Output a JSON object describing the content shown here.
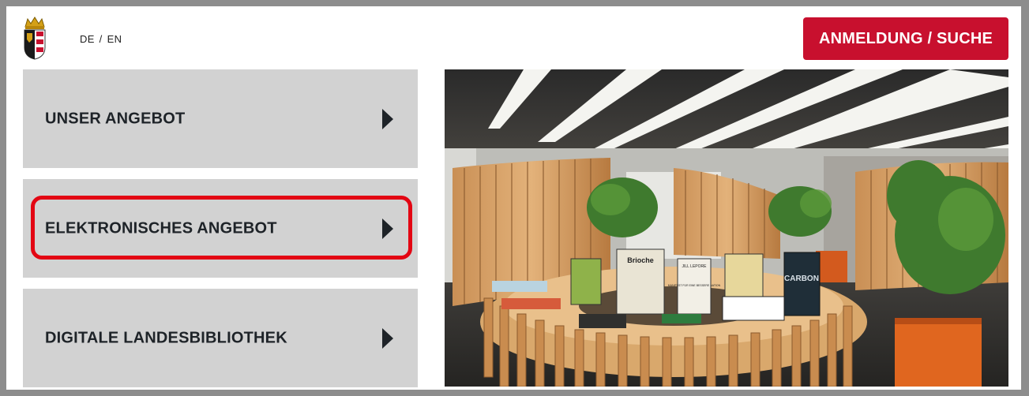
{
  "header": {
    "lang_de": "DE",
    "lang_sep": "/",
    "lang_en": "EN",
    "login_label": "ANMELDUNG / SUCHE"
  },
  "menu": {
    "items": [
      {
        "label": "UNSER ANGEBOT",
        "icon": "triangle-right-icon"
      },
      {
        "label": "ELEKTRONISCHES ANGEBOT",
        "icon": "triangle-right-icon"
      },
      {
        "label": "DIGITALE LANDESBIBLIOTHEK",
        "icon": "triangle-right-icon"
      }
    ],
    "highlighted_index": 1
  },
  "photo": {
    "book_titles": [
      "Brioche",
      "JILL LEPORE",
      "MANIFEST FÜR EINE BESSERE NATION",
      "CARBON"
    ]
  },
  "colors": {
    "accent": "#c8102e",
    "highlight": "#e30613",
    "tile": "#d2d2d2",
    "text_dark": "#1e2328"
  }
}
